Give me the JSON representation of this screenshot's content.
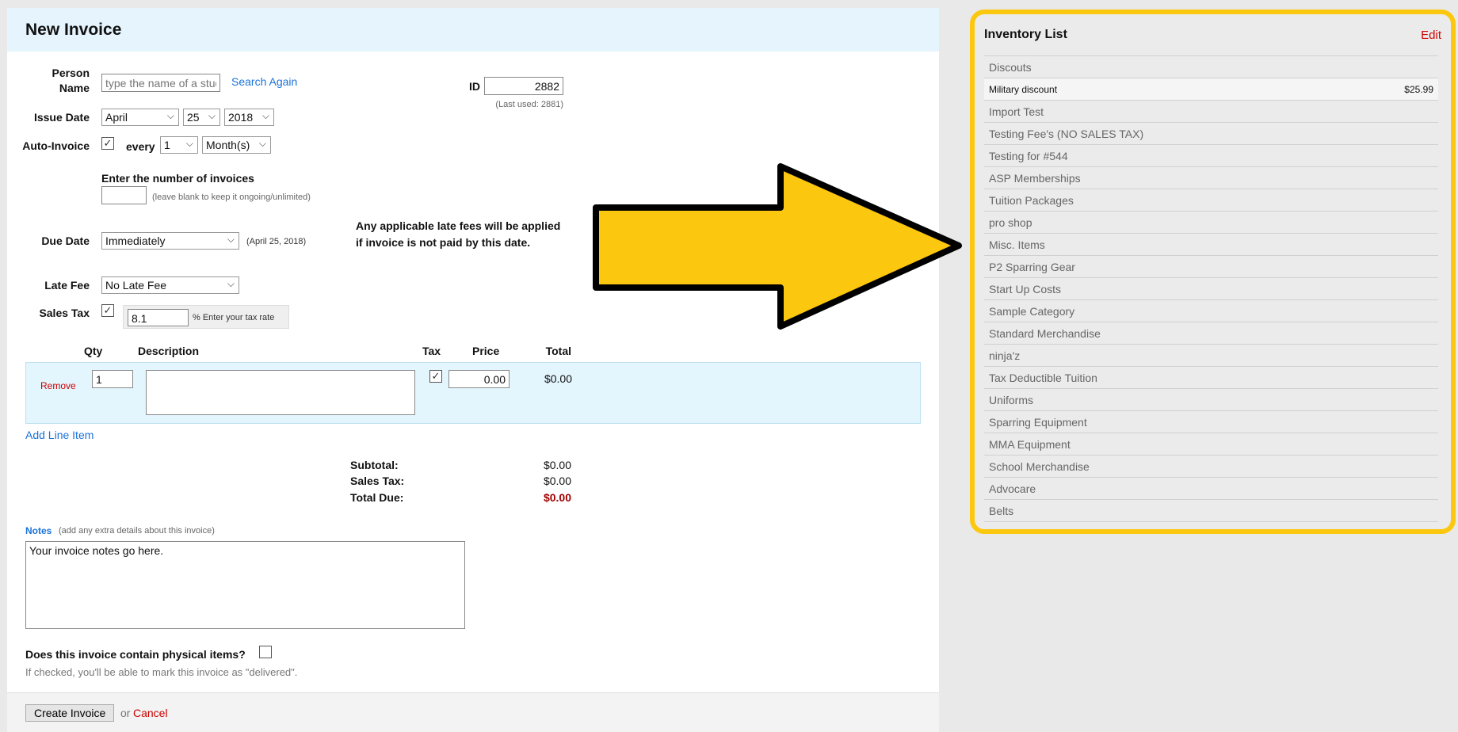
{
  "form": {
    "title": "New Invoice",
    "person_name_label": "Person Name",
    "person_name_placeholder": "type the name of a student",
    "search_again": "Search Again",
    "id_label": "ID",
    "id_value": "2882",
    "last_used": "(Last used: 2881)",
    "issue_date_label": "Issue Date",
    "issue_month": "April",
    "issue_day": "25",
    "issue_year": "2018",
    "auto_invoice_label": "Auto-Invoice",
    "every_label": "every",
    "every_value": "1",
    "every_unit": "Month(s)",
    "num_invoices_label": "Enter the number of invoices",
    "num_invoices_hint": "(leave blank to keep it ongoing/unlimited)",
    "due_date_label": "Due Date",
    "due_date_value": "Immediately",
    "due_date_hint": "(April 25, 2018)",
    "late_fee_note": "Any applicable late fees will be applied if invoice is not paid by this date.",
    "late_fee_label": "Late Fee",
    "late_fee_value": "No Late Fee",
    "sales_tax_label": "Sales Tax",
    "sales_tax_value": "8.1",
    "sales_tax_hint": "% Enter your tax rate",
    "columns": {
      "qty": "Qty",
      "description": "Description",
      "tax": "Tax",
      "price": "Price",
      "total": "Total"
    },
    "line_item": {
      "remove": "Remove",
      "qty": "1",
      "description": "",
      "price": "0.00",
      "total": "$0.00"
    },
    "add_line_item": "Add Line Item",
    "subtotal_label": "Subtotal:",
    "subtotal": "$0.00",
    "sales_tax_total_label": "Sales Tax:",
    "sales_tax_total": "$0.00",
    "total_due_label": "Total Due:",
    "total_due": "$0.00",
    "notes_label": "Notes",
    "notes_hint": "(add any extra details about this invoice)",
    "notes_value": "Your invoice notes go here.",
    "physical_label": "Does this invoice contain physical items?",
    "physical_hint": "If checked, you'll be able to mark this invoice as \"delivered\".",
    "create_button": "Create Invoice",
    "or": "or",
    "cancel": "Cancel"
  },
  "inventory": {
    "title": "Inventory List",
    "edit": "Edit",
    "sub_item": {
      "name": "Military discount",
      "price": "$25.99"
    },
    "items": [
      "Discouts",
      "Import Test",
      "Testing Fee's (NO SALES TAX)",
      "Testing for #544",
      "ASP Memberships",
      "Tuition Packages",
      "pro shop",
      "Misc. Items",
      "P2 Sparring Gear",
      "Start Up Costs",
      "Sample Category",
      "Standard Merchandise",
      "ninja'z",
      "Tax Deductible Tuition",
      "Uniforms",
      "Sparring Equipment",
      "MMA Equipment",
      "School Merchandise",
      "Advocare",
      "Belts"
    ]
  },
  "colors": {
    "accent": "#fcc70f",
    "link": "#1a73d9",
    "danger": "#cc0000"
  }
}
